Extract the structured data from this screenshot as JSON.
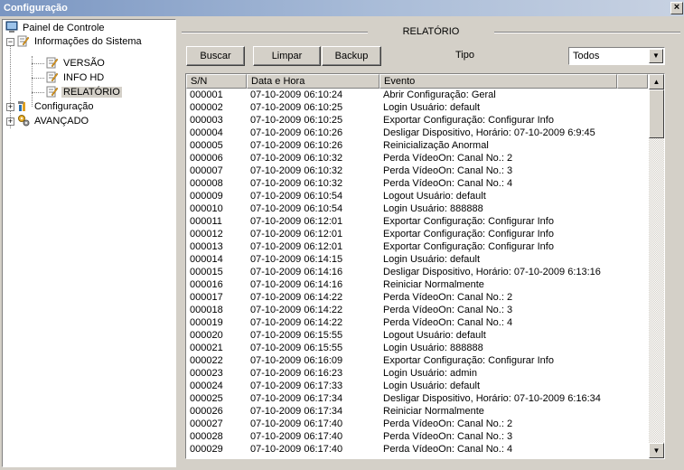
{
  "window": {
    "title": "Configuração",
    "close_label": "×"
  },
  "tree": {
    "root": "Painel de Controle",
    "info_sistema": "Informações do Sistema",
    "versao": "VERSÃO",
    "info_hd": "INFO HD",
    "relatorio": "RELATÓRIO",
    "configuracao": "Configuração",
    "avancado": "AVANÇADO"
  },
  "report": {
    "title": "RELATÓRIO",
    "buscar": "Buscar",
    "limpar": "Limpar",
    "backup": "Backup",
    "tipo_label": "Tipo",
    "tipo_value": "Todos"
  },
  "columns": {
    "sn": "S/N",
    "datetime": "Data e Hora",
    "event": "Evento"
  },
  "rows": [
    {
      "sn": "000001",
      "dt": "07-10-2009 06:10:24",
      "ev": "Abrir Configuração: Geral"
    },
    {
      "sn": "000002",
      "dt": "07-10-2009 06:10:25",
      "ev": "Login Usuário: default"
    },
    {
      "sn": "000003",
      "dt": "07-10-2009 06:10:25",
      "ev": "Exportar Configuração: Configurar Info"
    },
    {
      "sn": "000004",
      "dt": "07-10-2009 06:10:26",
      "ev": "Desligar Dispositivo, Horário: 07-10-2009 6:9:45"
    },
    {
      "sn": "000005",
      "dt": "07-10-2009 06:10:26",
      "ev": "Reinicialização Anormal"
    },
    {
      "sn": "000006",
      "dt": "07-10-2009 06:10:32",
      "ev": "Perda VídeoOn: Canal No.: 2"
    },
    {
      "sn": "000007",
      "dt": "07-10-2009 06:10:32",
      "ev": "Perda VídeoOn: Canal No.: 3"
    },
    {
      "sn": "000008",
      "dt": "07-10-2009 06:10:32",
      "ev": "Perda VídeoOn: Canal No.: 4"
    },
    {
      "sn": "000009",
      "dt": "07-10-2009 06:10:54",
      "ev": "Logout Usuário: default"
    },
    {
      "sn": "000010",
      "dt": "07-10-2009 06:10:54",
      "ev": "Login Usuário: 888888"
    },
    {
      "sn": "000011",
      "dt": "07-10-2009 06:12:01",
      "ev": "Exportar Configuração: Configurar Info"
    },
    {
      "sn": "000012",
      "dt": "07-10-2009 06:12:01",
      "ev": "Exportar Configuração: Configurar Info"
    },
    {
      "sn": "000013",
      "dt": "07-10-2009 06:12:01",
      "ev": "Exportar Configuração: Configurar Info"
    },
    {
      "sn": "000014",
      "dt": "07-10-2009 06:14:15",
      "ev": "Login Usuário: default"
    },
    {
      "sn": "000015",
      "dt": "07-10-2009 06:14:16",
      "ev": "Desligar Dispositivo, Horário: 07-10-2009 6:13:16"
    },
    {
      "sn": "000016",
      "dt": "07-10-2009 06:14:16",
      "ev": "Reiniciar Normalmente"
    },
    {
      "sn": "000017",
      "dt": "07-10-2009 06:14:22",
      "ev": "Perda VídeoOn: Canal No.: 2"
    },
    {
      "sn": "000018",
      "dt": "07-10-2009 06:14:22",
      "ev": "Perda VídeoOn: Canal No.: 3"
    },
    {
      "sn": "000019",
      "dt": "07-10-2009 06:14:22",
      "ev": "Perda VídeoOn: Canal No.: 4"
    },
    {
      "sn": "000020",
      "dt": "07-10-2009 06:15:55",
      "ev": "Logout Usuário: default"
    },
    {
      "sn": "000021",
      "dt": "07-10-2009 06:15:55",
      "ev": "Login Usuário: 888888"
    },
    {
      "sn": "000022",
      "dt": "07-10-2009 06:16:09",
      "ev": "Exportar Configuração: Configurar Info"
    },
    {
      "sn": "000023",
      "dt": "07-10-2009 06:16:23",
      "ev": "Login Usuário: admin"
    },
    {
      "sn": "000024",
      "dt": "07-10-2009 06:17:33",
      "ev": "Login Usuário: default"
    },
    {
      "sn": "000025",
      "dt": "07-10-2009 06:17:34",
      "ev": "Desligar Dispositivo, Horário: 07-10-2009 6:16:34"
    },
    {
      "sn": "000026",
      "dt": "07-10-2009 06:17:34",
      "ev": "Reiniciar Normalmente"
    },
    {
      "sn": "000027",
      "dt": "07-10-2009 06:17:40",
      "ev": "Perda VídeoOn: Canal No.: 2"
    },
    {
      "sn": "000028",
      "dt": "07-10-2009 06:17:40",
      "ev": "Perda VídeoOn: Canal No.: 3"
    },
    {
      "sn": "000029",
      "dt": "07-10-2009 06:17:40",
      "ev": "Perda VídeoOn: Canal No.: 4"
    }
  ]
}
